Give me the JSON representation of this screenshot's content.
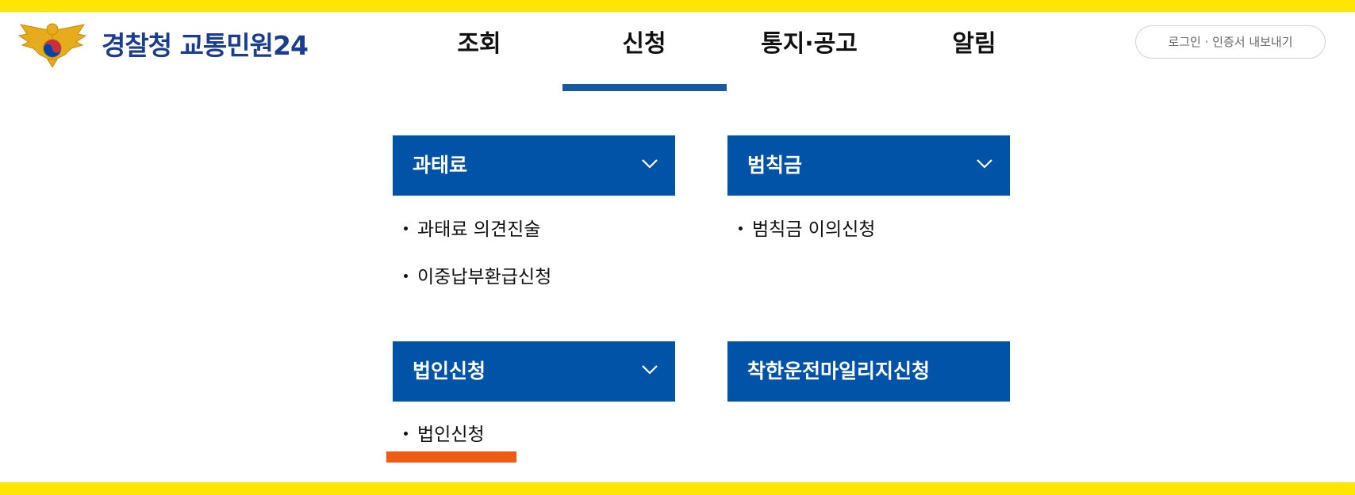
{
  "header": {
    "logo_text": "경찰청 교통민원24",
    "nav": [
      {
        "label": "조회"
      },
      {
        "label": "신청"
      },
      {
        "label": "통지·공고"
      },
      {
        "label": "알림"
      }
    ],
    "active_nav": "신청",
    "login_label": "로그인 · 인증서 내보내기"
  },
  "menu": {
    "panels": [
      {
        "title": "과태료",
        "has_dropdown": true,
        "items": [
          "과태료 의견진술",
          "이중납부환급신청"
        ]
      },
      {
        "title": "범칙금",
        "has_dropdown": true,
        "items": [
          "범칙금 이의신청"
        ]
      },
      {
        "title": "법인신청",
        "has_dropdown": true,
        "items": [
          "법인신청"
        ]
      },
      {
        "title": "착한운전마일리지신청",
        "has_dropdown": false,
        "items": []
      }
    ],
    "highlighted_item": "법인신청"
  },
  "colors": {
    "accent_yellow": "#ffe500",
    "panel_blue": "#0053a6",
    "logo_blue": "#1a3d8f",
    "active_bar": "#1a56a6",
    "highlight_orange": "#f05a14"
  },
  "icons": {
    "logo": "police-emblem-icon",
    "dropdown": "chevron-down-icon"
  }
}
